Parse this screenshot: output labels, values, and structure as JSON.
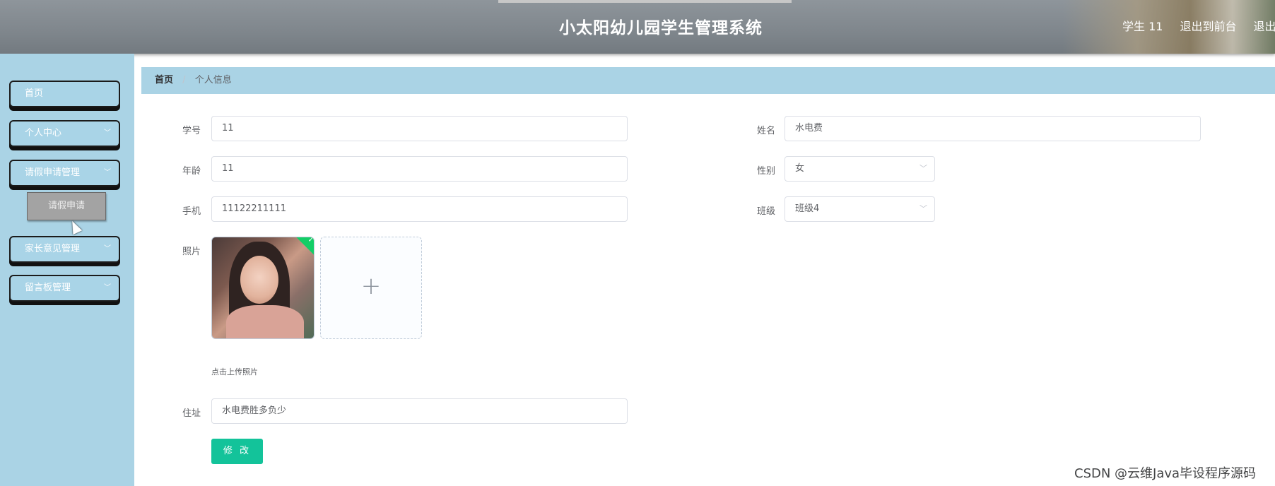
{
  "header": {
    "title": "小太阳幼儿园学生管理系统",
    "user": "学生 11",
    "to_front": "退出到前台",
    "logout": "退出登录"
  },
  "sidebar": {
    "items": [
      {
        "label": "首页",
        "has_children": false
      },
      {
        "label": "个人中心",
        "has_children": true
      },
      {
        "label": "请假申请管理",
        "has_children": true
      },
      {
        "label": "家长意见管理",
        "has_children": true
      },
      {
        "label": "留言板管理",
        "has_children": true
      }
    ],
    "submenu": {
      "label": "请假申请"
    }
  },
  "breadcrumb": {
    "home": "首页",
    "separator": "/",
    "current": "个人信息"
  },
  "form": {
    "student_no": {
      "label": "学号",
      "value": "11"
    },
    "name": {
      "label": "姓名",
      "value": "水电费"
    },
    "age": {
      "label": "年龄",
      "value": "11"
    },
    "gender": {
      "label": "性别",
      "value": "女"
    },
    "phone": {
      "label": "手机",
      "value": "11122211111"
    },
    "class": {
      "label": "班级",
      "value": "班级4"
    },
    "photo": {
      "label": "照片",
      "hint": "点击上传照片"
    },
    "address": {
      "label": "住址",
      "value": "水电费胜多负少"
    },
    "submit_label": "修 改"
  },
  "watermark": "CSDN @云维Java毕设程序源码",
  "colors": {
    "header_bg": "#80878d",
    "sidebar_bg": "#aad3e5",
    "submit_bg": "#13c39a",
    "upload_check": "#13ce66"
  }
}
